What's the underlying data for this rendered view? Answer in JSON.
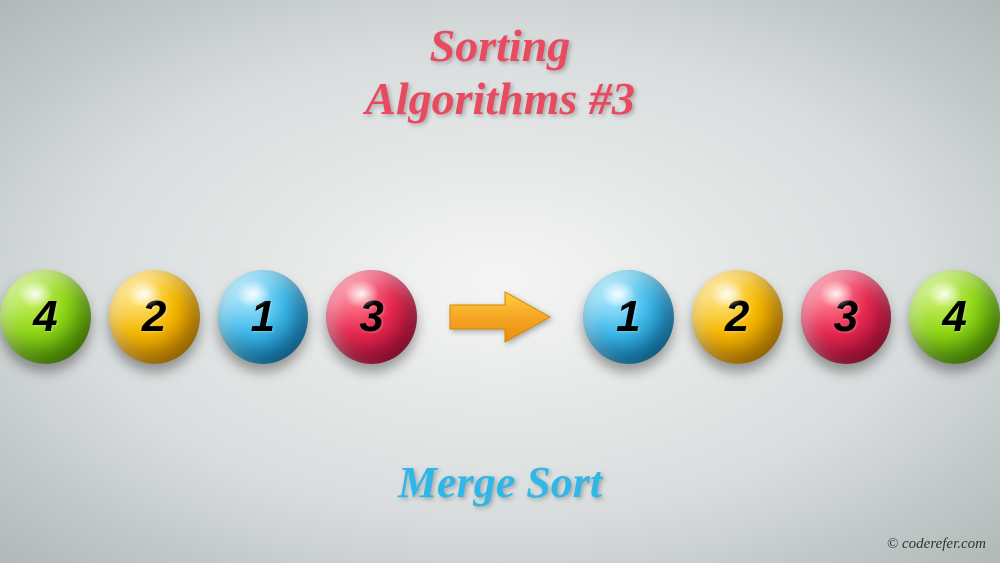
{
  "title_line1": "Sorting",
  "title_line2": "Algorithms #3",
  "subtitle": "Merge Sort",
  "copyright": "© coderefer.com",
  "balls_left": [
    {
      "num": "4",
      "color": "green"
    },
    {
      "num": "2",
      "color": "yellow"
    },
    {
      "num": "1",
      "color": "blue"
    },
    {
      "num": "3",
      "color": "red"
    }
  ],
  "balls_right": [
    {
      "num": "1",
      "color": "blue"
    },
    {
      "num": "2",
      "color": "yellow"
    },
    {
      "num": "3",
      "color": "red"
    },
    {
      "num": "4",
      "color": "green"
    }
  ],
  "arrow_color": "#f5a623"
}
